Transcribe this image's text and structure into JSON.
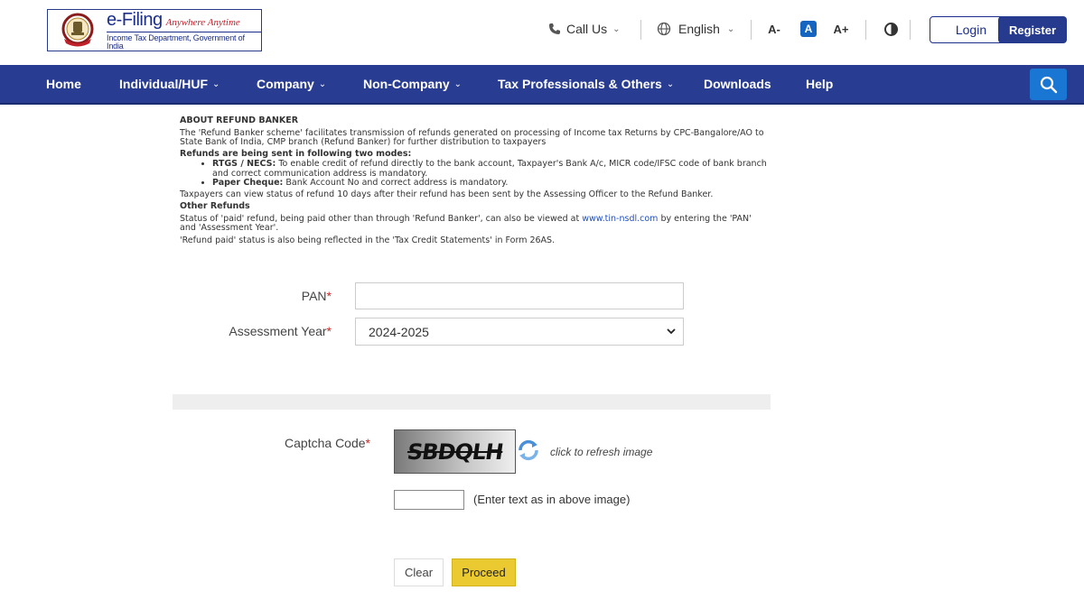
{
  "logo": {
    "title": "e-Filing",
    "tagline": "Anywhere Anytime",
    "subtitle": "Income Tax Department, Government of India",
    "emblem_icon": "national-emblem-icon"
  },
  "utility": {
    "call_us": "Call Us",
    "language": "English",
    "decrease_font": "A-",
    "normal_font": "A",
    "increase_font": "A+",
    "login": "Login",
    "register": "Register"
  },
  "nav": {
    "items": [
      {
        "label": "Home",
        "dropdown": false
      },
      {
        "label": "Individual/HUF",
        "dropdown": true
      },
      {
        "label": "Company",
        "dropdown": true
      },
      {
        "label": "Non-Company",
        "dropdown": true
      },
      {
        "label": "Tax Professionals & Others",
        "dropdown": true
      },
      {
        "label": "Downloads",
        "dropdown": false
      },
      {
        "label": "Help",
        "dropdown": false
      }
    ],
    "search_icon": "search-icon"
  },
  "info": {
    "heading": "ABOUT REFUND BANKER",
    "intro": "The 'Refund Banker scheme' facilitates transmission of refunds generated on processing of Income tax Returns by CPC-Bangalore/AO to State Bank of India, CMP branch (Refund Banker) for further distribution to taxpayers",
    "modes_heading": "Refunds are being sent in following two modes:",
    "mode1_title": "RTGS / NECS:",
    "mode1_text": "To enable credit of refund directly to the bank account, Taxpayer's Bank A/c, MICR code/IFSC code of bank branch and correct communication address is mandatory.",
    "mode2_title": "Paper Cheque:",
    "mode2_text": "Bank Account No and correct address is mandatory.",
    "status_note": "Taxpayers can view status of refund 10 days after their refund has been sent by the Assessing Officer to the Refund Banker.",
    "other_heading": "Other Refunds",
    "other_text_before": "Status of 'paid' refund, being paid other than through 'Refund Banker', can also be viewed at",
    "other_link": "www.tin-nsdl.com",
    "other_text_after": "by entering the 'PAN' and 'Assessment Year'.",
    "form26as_note": "'Refund paid' status is also being reflected in the 'Tax Credit Statements' in Form 26AS."
  },
  "form": {
    "pan_label": "PAN",
    "pan_value": "",
    "ay_label": "Assessment Year",
    "ay_value": "2024-2025",
    "required_mark": "*",
    "captcha_label": "Captcha Code",
    "captcha_text": "SBDQLH",
    "refresh_hint": "click to refresh image",
    "captcha_input_value": "",
    "captcha_hint": "(Enter text as in above image)",
    "clear": "Clear",
    "proceed": "Proceed"
  },
  "colors": {
    "nav_bg": "#283c92",
    "brand_blue": "#1a2e8a",
    "search_bg": "#1976d2",
    "proceed_bg": "#ebc930",
    "required": "#c62828"
  }
}
